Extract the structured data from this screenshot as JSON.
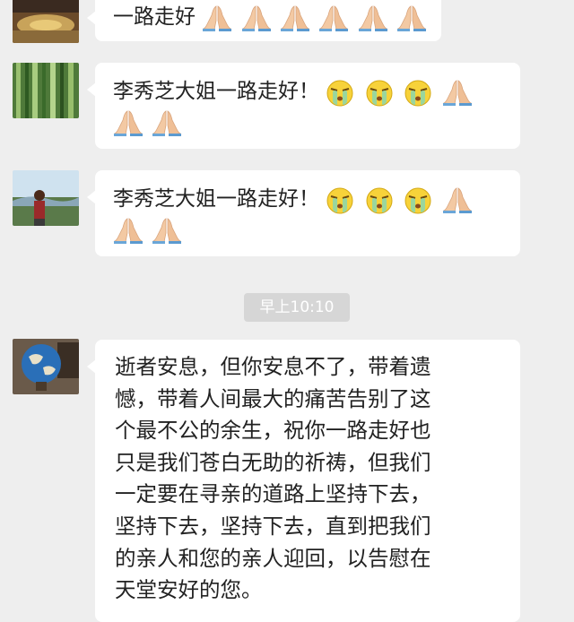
{
  "messages": [
    {
      "text_lines": [
        "一路走好"
      ],
      "trailing_emojis": [
        "folded-hands",
        "folded-hands",
        "folded-hands",
        "folded-hands",
        "folded-hands",
        "folded-hands"
      ]
    },
    {
      "text_lines": [
        "李秀芝大姐一路走好！"
      ],
      "trailing_emojis": [
        "crying-face",
        "crying-face",
        "crying-face",
        "folded-hands"
      ],
      "second_line_emojis": [
        "folded-hands",
        "folded-hands"
      ]
    },
    {
      "text_lines": [
        "李秀芝大姐一路走好！"
      ],
      "trailing_emojis": [
        "crying-face",
        "crying-face",
        "crying-face",
        "folded-hands"
      ],
      "second_line_emojis": [
        "folded-hands",
        "folded-hands"
      ]
    },
    {
      "text_lines": [
        "逝者安息，但你安息不了，带着遗",
        "憾，带着人间最大的痛苦告别了这",
        "个最不公的余生，祝你一路走好也",
        "只是我们苍白无助的祈祷，但我们",
        "一定要在寻亲的道路上坚持下去，",
        "坚持下去，坚持下去，直到把我们",
        "的亲人和您的亲人迎回，以告慰在",
        "天堂安好的您。"
      ]
    }
  ],
  "timestamp": "早上10:10",
  "colors": {
    "background": "#eeeeee",
    "bubble": "#ffffff",
    "timestamp_pill": "#d6d6d6"
  }
}
